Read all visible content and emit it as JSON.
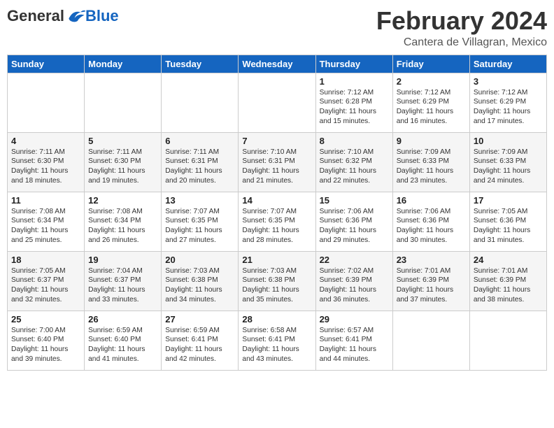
{
  "header": {
    "logo_general": "General",
    "logo_blue": "Blue",
    "title": "February 2024",
    "subtitle": "Cantera de Villagran, Mexico"
  },
  "days_of_week": [
    "Sunday",
    "Monday",
    "Tuesday",
    "Wednesday",
    "Thursday",
    "Friday",
    "Saturday"
  ],
  "weeks": [
    [
      {
        "day": "",
        "empty": true
      },
      {
        "day": "",
        "empty": true
      },
      {
        "day": "",
        "empty": true
      },
      {
        "day": "",
        "empty": true
      },
      {
        "day": "1",
        "sunrise": "7:12 AM",
        "sunset": "6:28 PM",
        "daylight": "11 hours and 15 minutes."
      },
      {
        "day": "2",
        "sunrise": "7:12 AM",
        "sunset": "6:29 PM",
        "daylight": "11 hours and 16 minutes."
      },
      {
        "day": "3",
        "sunrise": "7:12 AM",
        "sunset": "6:29 PM",
        "daylight": "11 hours and 17 minutes."
      }
    ],
    [
      {
        "day": "4",
        "sunrise": "7:11 AM",
        "sunset": "6:30 PM",
        "daylight": "11 hours and 18 minutes."
      },
      {
        "day": "5",
        "sunrise": "7:11 AM",
        "sunset": "6:30 PM",
        "daylight": "11 hours and 19 minutes."
      },
      {
        "day": "6",
        "sunrise": "7:11 AM",
        "sunset": "6:31 PM",
        "daylight": "11 hours and 20 minutes."
      },
      {
        "day": "7",
        "sunrise": "7:10 AM",
        "sunset": "6:31 PM",
        "daylight": "11 hours and 21 minutes."
      },
      {
        "day": "8",
        "sunrise": "7:10 AM",
        "sunset": "6:32 PM",
        "daylight": "11 hours and 22 minutes."
      },
      {
        "day": "9",
        "sunrise": "7:09 AM",
        "sunset": "6:33 PM",
        "daylight": "11 hours and 23 minutes."
      },
      {
        "day": "10",
        "sunrise": "7:09 AM",
        "sunset": "6:33 PM",
        "daylight": "11 hours and 24 minutes."
      }
    ],
    [
      {
        "day": "11",
        "sunrise": "7:08 AM",
        "sunset": "6:34 PM",
        "daylight": "11 hours and 25 minutes."
      },
      {
        "day": "12",
        "sunrise": "7:08 AM",
        "sunset": "6:34 PM",
        "daylight": "11 hours and 26 minutes."
      },
      {
        "day": "13",
        "sunrise": "7:07 AM",
        "sunset": "6:35 PM",
        "daylight": "11 hours and 27 minutes."
      },
      {
        "day": "14",
        "sunrise": "7:07 AM",
        "sunset": "6:35 PM",
        "daylight": "11 hours and 28 minutes."
      },
      {
        "day": "15",
        "sunrise": "7:06 AM",
        "sunset": "6:36 PM",
        "daylight": "11 hours and 29 minutes."
      },
      {
        "day": "16",
        "sunrise": "7:06 AM",
        "sunset": "6:36 PM",
        "daylight": "11 hours and 30 minutes."
      },
      {
        "day": "17",
        "sunrise": "7:05 AM",
        "sunset": "6:36 PM",
        "daylight": "11 hours and 31 minutes."
      }
    ],
    [
      {
        "day": "18",
        "sunrise": "7:05 AM",
        "sunset": "6:37 PM",
        "daylight": "11 hours and 32 minutes."
      },
      {
        "day": "19",
        "sunrise": "7:04 AM",
        "sunset": "6:37 PM",
        "daylight": "11 hours and 33 minutes."
      },
      {
        "day": "20",
        "sunrise": "7:03 AM",
        "sunset": "6:38 PM",
        "daylight": "11 hours and 34 minutes."
      },
      {
        "day": "21",
        "sunrise": "7:03 AM",
        "sunset": "6:38 PM",
        "daylight": "11 hours and 35 minutes."
      },
      {
        "day": "22",
        "sunrise": "7:02 AM",
        "sunset": "6:39 PM",
        "daylight": "11 hours and 36 minutes."
      },
      {
        "day": "23",
        "sunrise": "7:01 AM",
        "sunset": "6:39 PM",
        "daylight": "11 hours and 37 minutes."
      },
      {
        "day": "24",
        "sunrise": "7:01 AM",
        "sunset": "6:39 PM",
        "daylight": "11 hours and 38 minutes."
      }
    ],
    [
      {
        "day": "25",
        "sunrise": "7:00 AM",
        "sunset": "6:40 PM",
        "daylight": "11 hours and 39 minutes."
      },
      {
        "day": "26",
        "sunrise": "6:59 AM",
        "sunset": "6:40 PM",
        "daylight": "11 hours and 41 minutes."
      },
      {
        "day": "27",
        "sunrise": "6:59 AM",
        "sunset": "6:41 PM",
        "daylight": "11 hours and 42 minutes."
      },
      {
        "day": "28",
        "sunrise": "6:58 AM",
        "sunset": "6:41 PM",
        "daylight": "11 hours and 43 minutes."
      },
      {
        "day": "29",
        "sunrise": "6:57 AM",
        "sunset": "6:41 PM",
        "daylight": "11 hours and 44 minutes."
      },
      {
        "day": "",
        "empty": true
      },
      {
        "day": "",
        "empty": true
      }
    ]
  ]
}
